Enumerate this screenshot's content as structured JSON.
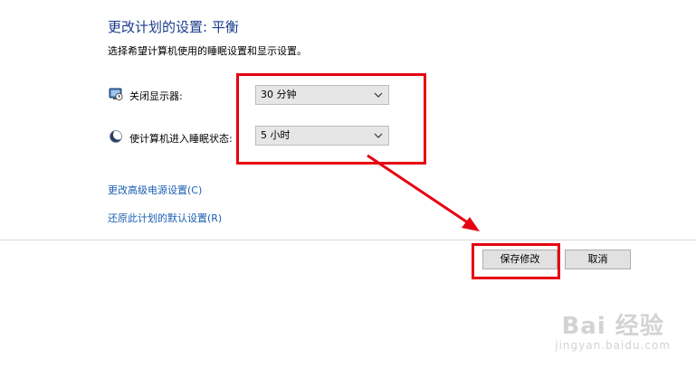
{
  "header": {
    "title": "更改计划的设置: 平衡",
    "subtitle": "选择希望计算机使用的睡眠设置和显示设置。"
  },
  "settings": [
    {
      "label": "关闭显示器:",
      "value": "30 分钟",
      "icon": "monitor-clock-icon"
    },
    {
      "label": "使计算机进入睡眠状态:",
      "value": "5 小时",
      "icon": "moon-sleep-icon"
    }
  ],
  "links": {
    "advanced": "更改高级电源设置(C)",
    "restore": "还原此计划的默认设置(R)"
  },
  "buttons": {
    "save": "保存修改",
    "cancel": "取消"
  },
  "annotation": {
    "color": "#e60012"
  },
  "watermark": {
    "main": "Bai 经验",
    "sub": "jingyan.baidu.com"
  }
}
